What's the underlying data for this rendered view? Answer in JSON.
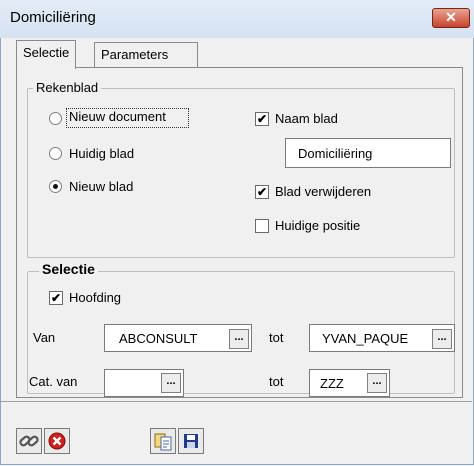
{
  "window": {
    "title": "Domiciliëring",
    "close_glyph": "✕"
  },
  "tabs": [
    {
      "label": "Selectie"
    },
    {
      "label": "Parameters"
    }
  ],
  "rekenblad": {
    "legend": "Rekenblad",
    "radios": [
      {
        "label": "Nieuw document",
        "checked": false
      },
      {
        "label": "Huidig blad",
        "checked": false
      },
      {
        "label": "Nieuw blad",
        "checked": true
      }
    ],
    "naam_blad": {
      "label": "Naam blad",
      "checked": true,
      "value": "Domiciliëring"
    },
    "blad_verwijderen": {
      "label": "Blad verwijderen",
      "checked": true
    },
    "huidige_positie": {
      "label": "Huidige positie",
      "checked": false
    }
  },
  "selectie": {
    "legend": "Selectie",
    "hoofding": {
      "label": "Hoofding",
      "checked": true
    },
    "van_label": "Van",
    "van_value": "ABCONSULT",
    "tot_label": "tot",
    "tot_value": "YVAN_PAQUE",
    "cat_label": "Cat. van",
    "cat_value": "",
    "cat_tot_label": "tot",
    "cat_tot_value": "ZZZ",
    "browse_label": "..."
  },
  "toolbar": [
    {
      "icon": "link-icon"
    },
    {
      "icon": "cancel-icon"
    },
    {
      "icon": "copy-icon"
    },
    {
      "icon": "save-icon"
    }
  ],
  "colors": {
    "close": "#c7432c",
    "cancel": "#d02020",
    "save": "#1f3a8a"
  }
}
